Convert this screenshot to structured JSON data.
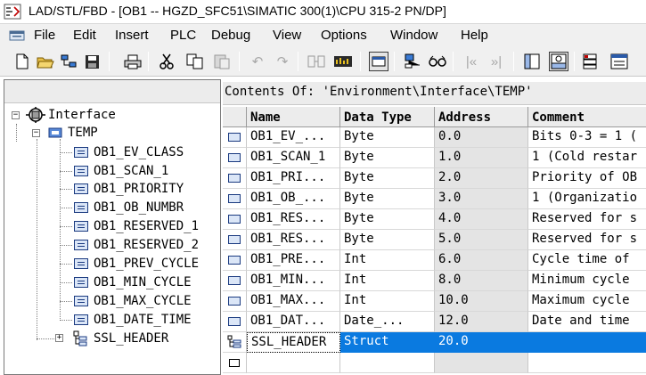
{
  "window": {
    "title": "LAD/STL/FBD  - [OB1 -- HGZD_SFC51\\SIMATIC 300(1)\\CPU 315-2 PN/DP]"
  },
  "menubar": {
    "items": [
      "File",
      "Edit",
      "Insert",
      "PLC",
      "Debug",
      "View",
      "Options",
      "Window",
      "Help"
    ]
  },
  "toolbar": {
    "buttons": [
      "new-icon",
      "open-icon",
      "accessible-nodes-icon",
      "save-icon",
      "print-icon",
      "cut-icon",
      "copy-icon",
      "paste-icon",
      "undo-icon",
      "redo-icon",
      "online-icon",
      "monitor-icon",
      "window-icon",
      "network-icon",
      "glasses-icon",
      "prev-error-icon",
      "next-error-icon",
      "overview-icon",
      "details-icon",
      "program-elements-icon",
      "call-structure-icon"
    ]
  },
  "tree": {
    "root": "Interface",
    "temp": "TEMP",
    "items": [
      "OB1_EV_CLASS",
      "OB1_SCAN_1",
      "OB1_PRIORITY",
      "OB1_OB_NUMBR",
      "OB1_RESERVED_1",
      "OB1_RESERVED_2",
      "OB1_PREV_CYCLE",
      "OB1_MIN_CYCLE",
      "OB1_MAX_CYCLE",
      "OB1_DATE_TIME"
    ],
    "struct_item": "SSL_HEADER"
  },
  "contents": {
    "title": "Contents Of: 'Environment\\Interface\\TEMP'",
    "columns": [
      "Name",
      "Data Type",
      "Address",
      "Comment"
    ],
    "rows": [
      {
        "name": "OB1_EV_...",
        "type": "Byte",
        "address": "0.0",
        "comment": "Bits 0-3 = 1 ("
      },
      {
        "name": "OB1_SCAN_1",
        "type": "Byte",
        "address": "1.0",
        "comment": "1 (Cold restar"
      },
      {
        "name": "OB1_PRI...",
        "type": "Byte",
        "address": "2.0",
        "comment": "Priority of OB"
      },
      {
        "name": "OB1_OB_...",
        "type": "Byte",
        "address": "3.0",
        "comment": "1 (Organizatio"
      },
      {
        "name": "OB1_RES...",
        "type": "Byte",
        "address": "4.0",
        "comment": "Reserved for s"
      },
      {
        "name": "OB1_RES...",
        "type": "Byte",
        "address": "5.0",
        "comment": "Reserved for s"
      },
      {
        "name": "OB1_PRE...",
        "type": "Int",
        "address": "6.0",
        "comment": "Cycle time of "
      },
      {
        "name": "OB1_MIN...",
        "type": "Int",
        "address": "8.0",
        "comment": "Minimum cycle "
      },
      {
        "name": "OB1_MAX...",
        "type": "Int",
        "address": "10.0",
        "comment": "Maximum cycle "
      },
      {
        "name": "OB1_DAT...",
        "type": "Date_...",
        "address": "12.0",
        "comment": "Date and time "
      },
      {
        "name": "SSL_HEADER",
        "type": "Struct",
        "address": "20.0",
        "comment": ""
      },
      {
        "name": "",
        "type": "",
        "address": "",
        "comment": ""
      }
    ]
  },
  "colors": {
    "selection": "#0a7ae0",
    "address_bg": "#e4e4e4"
  }
}
